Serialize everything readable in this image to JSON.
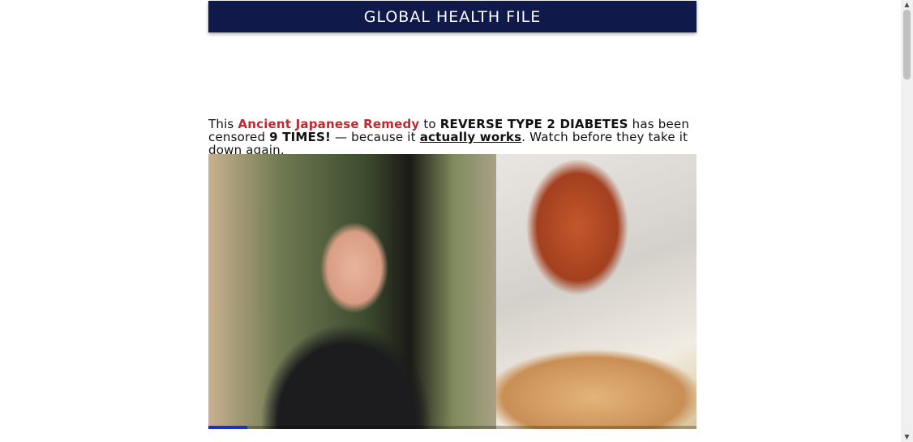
{
  "header": {
    "title": "GLOBAL HEALTH FILE",
    "background_color": "#0f1a4a"
  },
  "headline": {
    "part1": "This ",
    "highlight_red": "Ancient Japanese Remedy",
    "part2": " to ",
    "highlight_bold": "REVERSE TYPE 2 DIABETES",
    "part3": " has been censored ",
    "highlight_times": "9 TIMES!",
    "part4": " — because it ",
    "link_text": "actually works",
    "part5": ". Watch before they take it down again.",
    "red_color": "#c1272d"
  },
  "video": {
    "progress_fraction": 0.08,
    "progress_color": "#1a2fd1"
  },
  "scrollbar": {
    "up_icon": "triangle-up-icon",
    "down_icon": "triangle-down-icon"
  }
}
